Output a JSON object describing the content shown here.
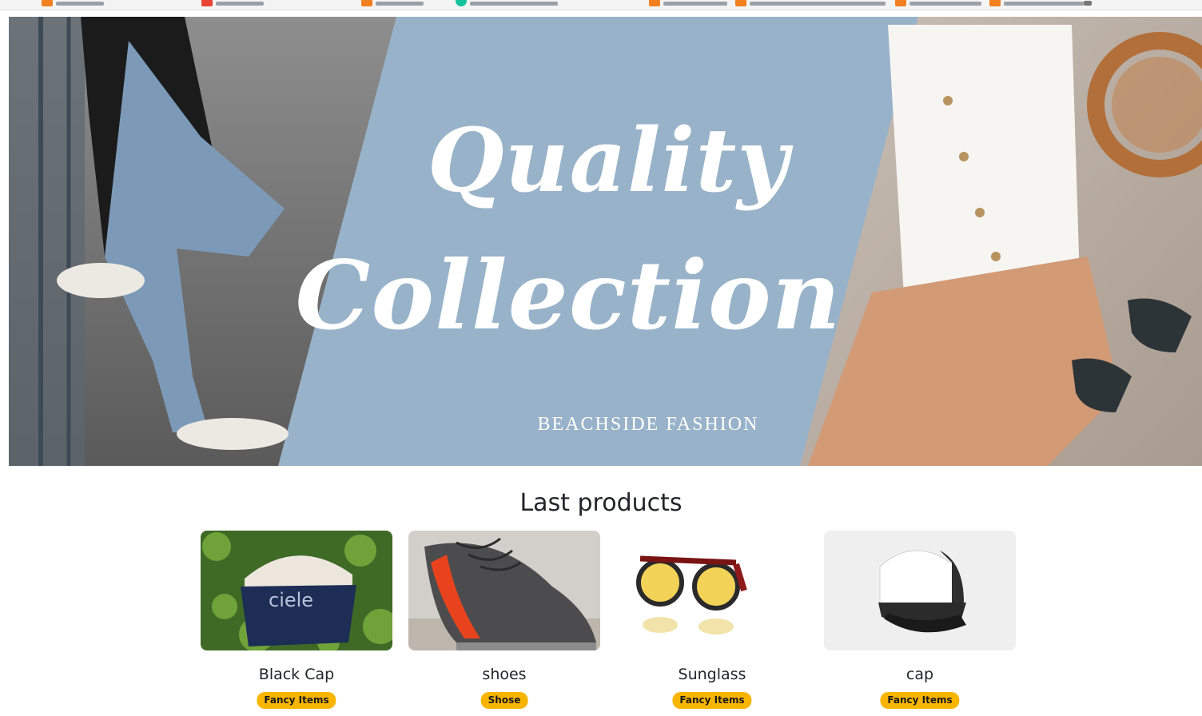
{
  "hero": {
    "title_line1": "Quality",
    "title_line2": "Collection",
    "subtitle": "BEACHSIDE FASHION",
    "accent_color": "#98b2c9"
  },
  "section": {
    "title": "Last products"
  },
  "products": [
    {
      "name": "Black Cap",
      "category": "Fancy Items",
      "image": "cap-photo"
    },
    {
      "name": "shoes",
      "category": "Shose",
      "image": "sneaker-photo"
    },
    {
      "name": "Sunglass",
      "category": "Fancy Items",
      "image": "sunglasses-photo"
    },
    {
      "name": "cap",
      "category": "Fancy Items",
      "image": "trucker-cap-photo"
    }
  ],
  "colors": {
    "badge": "#f7b500",
    "text": "#212529"
  }
}
